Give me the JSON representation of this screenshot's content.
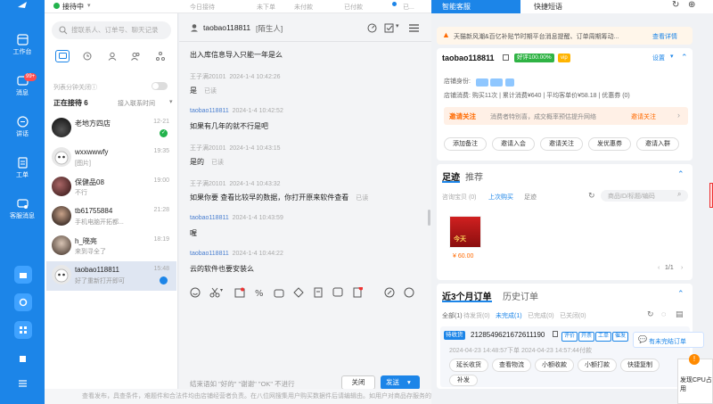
{
  "topbar": {
    "status": "接待中",
    "stats": [
      "今日接待",
      "未下单",
      "未付款",
      "已付款"
    ]
  },
  "rail": {
    "items": [
      {
        "label": "工作台",
        "icon": "workbench-icon"
      },
      {
        "label": "消息",
        "icon": "message-icon",
        "badge": "99+"
      },
      {
        "label": "讲话",
        "icon": "chat-bubble-icon"
      },
      {
        "label": "工单",
        "icon": "ticket-icon"
      },
      {
        "label": "客服消息",
        "icon": "service-message-icon"
      }
    ]
  },
  "contacts": {
    "search_placeholder": "搜联系人、订单号、聊天记录",
    "auto_close": "列表分钟关闭",
    "pending_label": "正在接待 6",
    "join_queue": "接入联系时间",
    "list": [
      {
        "name": "老地方四店",
        "sub": "",
        "time": "12-21"
      },
      {
        "name": "wxxwwwfy",
        "sub": "[图片]",
        "time": "19:35"
      },
      {
        "name": "保健品08",
        "sub": "不行",
        "time": "19:00"
      },
      {
        "name": "tb61755884",
        "sub": "手机电脑开拓都...",
        "time": "21:28"
      },
      {
        "name": "h_晓亮",
        "sub": "来到寻全了",
        "time": "18:19"
      },
      {
        "name": "taobao118811",
        "sub": "好了重新打开即可",
        "time": "15:48"
      }
    ]
  },
  "chat": {
    "title": "taobao118811",
    "title_tag": "[陌生人]",
    "intro": "出入库信息导入只能一年是么",
    "messages": [
      {
        "sender": "王子满20101",
        "time": "2024-1-4 10:42:26",
        "text": "是",
        "read": "已读",
        "me": false
      },
      {
        "sender": "taobao118811",
        "time": "2024-1-4 10:42:52",
        "text": "如果有几年的就不行是吧",
        "read": "",
        "me": true
      },
      {
        "sender": "王子满20101",
        "time": "2024-1-4 10:43:15",
        "text": "是的",
        "read": "已读",
        "me": false
      },
      {
        "sender": "王子满20101",
        "time": "2024-1-4 10:43:32",
        "text": "如果你要 查看比较早的数据，你打开原来软件查看",
        "read": "已读",
        "me": false
      },
      {
        "sender": "taobao118811",
        "time": "2024-1-4 10:43:59",
        "text": "喔",
        "read": "",
        "me": true
      },
      {
        "sender": "taobao118811",
        "time": "2024-1-4 10:44:22",
        "text": "云的软件也要安装么",
        "read": "",
        "me": true
      }
    ],
    "quick_replies": "结束语如 \"好的\"   \"谢谢\"   \"OK\" 不进行",
    "close_label": "关闭",
    "send_label": "发送"
  },
  "right": {
    "tabs": [
      "智能客服",
      "快捷短语"
    ],
    "notice": "天猫新风潮&百亿补贴节时期平台消息提醒、订单周期筹动...",
    "notice_link": "查看详情",
    "buyer_name": "taobao118811",
    "reputation": "好评100.00%",
    "settings": "设置",
    "identity_label": "店铺身份:",
    "stats_line": "店铺消费: 购买11次 | 累计消费¥640 | 平均客单价¥58.18 | 优惠券 (0)",
    "coupon_text": "消费者特别喜，成交概率预估提升网络",
    "coupon_link": "邀请关注",
    "coupon_title": "邀请关注",
    "actions": [
      "添加备注",
      "邀请入会",
      "邀请关注",
      "发优惠券",
      "邀请入群"
    ],
    "footprint_tabs": [
      "足迹",
      "推荐"
    ],
    "footprint_filters": [
      "咨询宝贝 (0)",
      "上次购买",
      "足迹"
    ],
    "search_placeholder": "商品ID/标题/编码",
    "product_price": "¥ 60.00",
    "product_badge": "今天",
    "pagination": "1/1",
    "order_tabs": [
      "近3个月订单",
      "历史订单"
    ],
    "order_filters": [
      "全部(1)",
      "待发货(0)",
      "未完成(1)",
      "已完成(0)",
      "已关闭(0)"
    ],
    "order_status": "待收货",
    "order_id": "2128549621672611190",
    "order_tags": [
      "评价",
      "开票",
      "工单",
      "催发"
    ],
    "order_time": "2024-04-23 14:48:57下单    2024-04-23 14:57:44付款",
    "order_actions": [
      "延长收货",
      "查看物流",
      "小额收款",
      "小额打款",
      "快捷复制",
      "补发"
    ],
    "unsettled": "有未完结订单",
    "side_note": "发现CPU占用"
  },
  "footer": {
    "text": "查看发布，具查条件，难题件和合法件均由店铺经营者负责。在八位网搜集用户购买数据件后请编辑由。如用户对商品存服务的价格、特价赞往同信"
  }
}
